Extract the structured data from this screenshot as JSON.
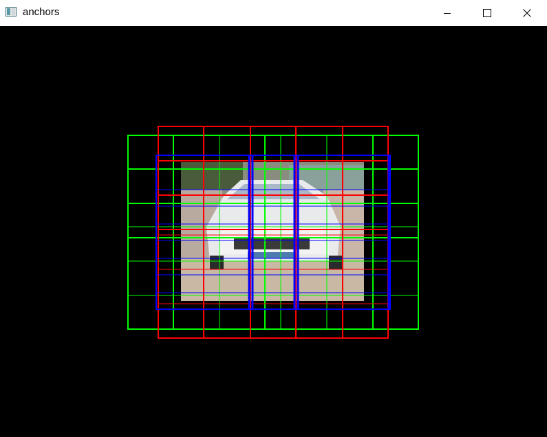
{
  "window": {
    "title": "anchors",
    "controls": {
      "minimize": "minimize-icon",
      "maximize": "maximize-icon",
      "close": "close-icon"
    }
  },
  "canvas": {
    "background_color": "#000000",
    "image_content": "car-photo",
    "anchor_colors": {
      "green": "#00ff00",
      "red": "#ff0000",
      "blue": "#0000ff"
    }
  }
}
